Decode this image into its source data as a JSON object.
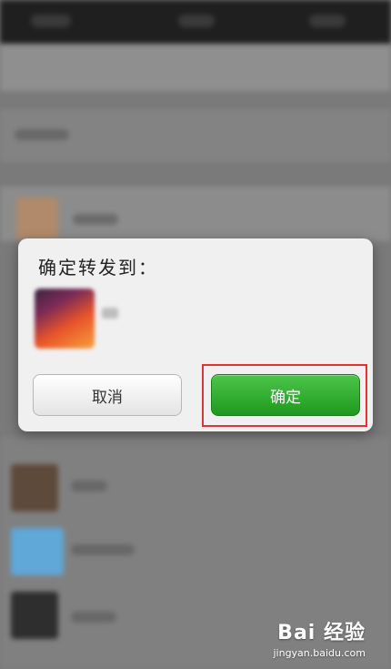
{
  "dialog": {
    "title": "确定转发到：",
    "cancel_label": "取消",
    "confirm_label": "确定"
  },
  "watermark": {
    "brand": "Bai 经验",
    "url": "jingyan.baidu.com"
  },
  "colors": {
    "confirm_green": "#2aa82a",
    "highlight_red": "#e03434"
  }
}
